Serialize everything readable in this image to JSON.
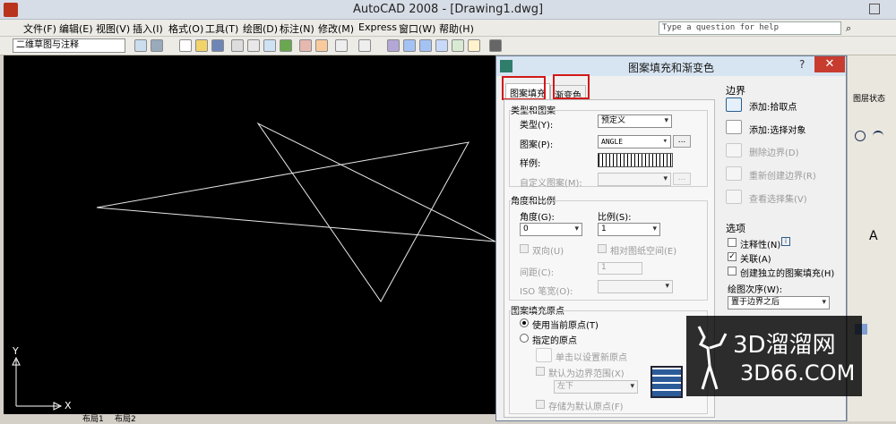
{
  "window": {
    "title": "AutoCAD 2008 - [Drawing1.dwg]"
  },
  "menu": [
    {
      "label": "文件(F)"
    },
    {
      "label": "编辑(E)"
    },
    {
      "label": "视图(V)"
    },
    {
      "label": "插入(I)"
    },
    {
      "label": "格式(O)"
    },
    {
      "label": "工具(T)"
    },
    {
      "label": "绘图(D)"
    },
    {
      "label": "标注(N)"
    },
    {
      "label": "修改(M)"
    },
    {
      "label": "Express"
    },
    {
      "label": "窗口(W)"
    },
    {
      "label": "帮助(H)"
    }
  ],
  "help": {
    "placeholder": "Type a question for help"
  },
  "toolbar": {
    "workspace": "二维草图与注释"
  },
  "canvas": {
    "axis_x": "X",
    "axis_y": "Y",
    "tab_model": "布局1",
    "tab_layout": "布局2"
  },
  "dialog": {
    "title": "图案填充和渐变色",
    "help_btn": "?",
    "close_btn": "✕",
    "tabs": [
      {
        "label": "图案填充"
      },
      {
        "label": "渐变色"
      }
    ],
    "type_group": {
      "title": "类型和图案",
      "type_label": "类型(Y):",
      "type_value": "预定义",
      "pattern_label": "图案(P):",
      "pattern_value": "ANGLE",
      "swatch_label": "样例:",
      "custom_label": "自定义图案(M):",
      "dots": "..."
    },
    "angle_group": {
      "title": "角度和比例",
      "angle_label": "角度(G):",
      "angle_value": "0",
      "scale_label": "比例(S):",
      "scale_value": "1",
      "double_label": "双向(U)",
      "relative_label": "相对图纸空间(E)",
      "spacing_label": "间距(C):",
      "spacing_value": "1",
      "iso_label": "ISO 笔宽(O):"
    },
    "origin_group": {
      "title": "图案填充原点",
      "use_current": "使用当前原点(T)",
      "specified": "指定的原点",
      "click_set": "单击以设置新原点",
      "default_boundary": "默认为边界范围(X)",
      "position_value": "左下",
      "store_default": "存储为默认原点(F)"
    },
    "boundary": {
      "title": "边界",
      "add_pick": "添加:拾取点",
      "add_select": "添加:选择对象",
      "remove": "删除边界(D)",
      "recreate": "重新创建边界(R)",
      "view_selection": "查看选择集(V)"
    },
    "options": {
      "title": "选项",
      "annotative": "注释性(N)",
      "associative": "关联(A)",
      "separate": "创建独立的图案填充(H)",
      "draw_order_label": "绘图次序(W):",
      "draw_order_value": "置于边界之后"
    }
  },
  "right_panel": {
    "layer_state": "图层状态"
  },
  "watermark": {
    "brand": "3D溜溜网",
    "domain": "3D66.COM"
  },
  "colors": {
    "canvas": "#000000",
    "highlight": "#d21919",
    "close": "#c83c30"
  }
}
